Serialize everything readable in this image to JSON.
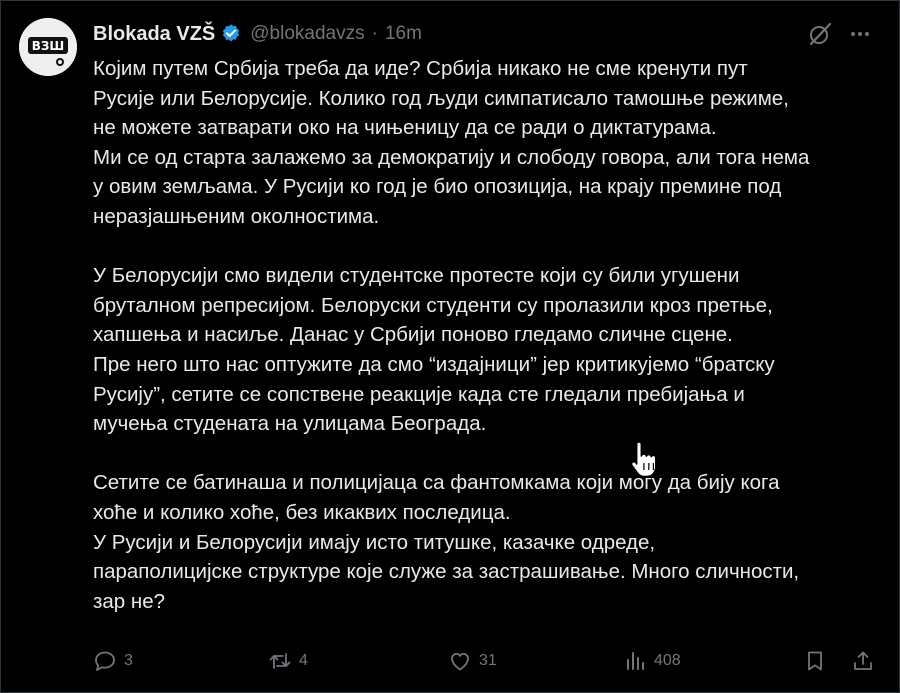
{
  "tweet": {
    "display_name": "Blokada VZŠ",
    "handle": "@blokadavzs",
    "separator": "·",
    "time": "16m",
    "avatar_text": "ВЗШ",
    "text": "Којим путем Србија треба да иде? Србија никако не сме кренути пут\nРусије или Белорусије. Колико год људи симпатисало тамошње режиме,\nне можете затварати око на чињеницу да се ради о диктатурама.\nМи се од старта залажемо за демократију и слободу говора, али тога нема\nу овим земљама. У Русији ко год је био опозиција, на крају премине под\nнеразјашњеним околностима.\n\nУ Белорусији смо видели студентске протесте који су били угушени\nбруталном репресијом. Белоруски студенти су пролазили кроз претње,\nхапшења и насиље. Данас у Србији поново гледамо сличне сцене.\nПре него што нас оптужите да смо “издајници” јер критикујемо “братску\nРусију”, сетите се сопствене реакције када сте гледали пребијања и\nмучења студената на улицама Београда.\n\nСетите се батинаша и полицијаца са фантомкама који могу да бију кога\nхоће и колико хоће, без икаквих последица.\nУ Русији и Белорусији имају исто титушке, казачке одреде,\nпараполицијске структуре које служе за застрашивање. Много сличности,\nзар не?"
  },
  "actions": {
    "reply_count": "3",
    "retweet_count": "4",
    "like_count": "31",
    "views_count": "408"
  },
  "icons": {
    "verified": "verified-badge-icon",
    "grok": "grok-icon",
    "more": "more-icon",
    "reply": "reply-icon",
    "retweet": "retweet-icon",
    "like": "heart-icon",
    "views": "views-icon",
    "bookmark": "bookmark-icon",
    "share": "share-icon",
    "cursor": "hand-cursor-icon"
  },
  "colors": {
    "background": "#000000",
    "text": "#e7e9ea",
    "muted": "#71767b",
    "verified_blue": "#1d9bf0"
  }
}
